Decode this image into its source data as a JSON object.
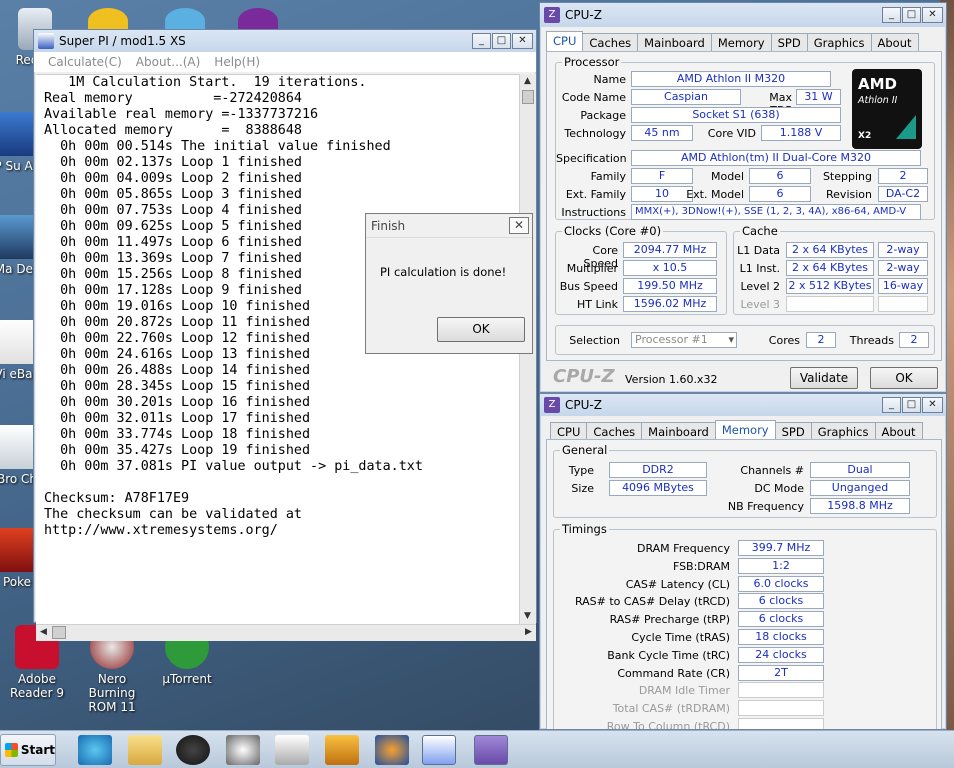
{
  "desktop": {
    "left_labels": [
      "Recycl",
      "HP Su Assi",
      "Ma Des",
      "Vi eBay",
      "Bro Ch",
      "Poke"
    ],
    "bottom_icons": [
      {
        "label": "Adobe Reader 9",
        "icon": "adobe-reader-icon"
      },
      {
        "label": "Nero Burning ROM 11",
        "icon": "nero-icon"
      },
      {
        "label": "µTorrent",
        "icon": "utorrent-icon"
      }
    ]
  },
  "superpi": {
    "title": "Super PI / mod1.5 XS",
    "menu": [
      "Calculate(C)",
      "About...(A)",
      "Help(H)"
    ],
    "output": [
      "   1M Calculation Start.  19 iterations.",
      "Real memory          =-272420864",
      "Available real memory =-1337737216",
      "Allocated memory      =  8388648",
      "  0h 00m 00.514s The initial value finished",
      "  0h 00m 02.137s Loop 1 finished",
      "  0h 00m 04.009s Loop 2 finished",
      "  0h 00m 05.865s Loop 3 finished",
      "  0h 00m 07.753s Loop 4 finished",
      "  0h 00m 09.625s Loop 5 finished",
      "  0h 00m 11.497s Loop 6 finished",
      "  0h 00m 13.369s Loop 7 finished",
      "  0h 00m 15.256s Loop 8 finished",
      "  0h 00m 17.128s Loop 9 finished",
      "  0h 00m 19.016s Loop 10 finished",
      "  0h 00m 20.872s Loop 11 finished",
      "  0h 00m 22.760s Loop 12 finished",
      "  0h 00m 24.616s Loop 13 finished",
      "  0h 00m 26.488s Loop 14 finished",
      "  0h 00m 28.345s Loop 15 finished",
      "  0h 00m 30.201s Loop 16 finished",
      "  0h 00m 32.011s Loop 17 finished",
      "  0h 00m 33.774s Loop 18 finished",
      "  0h 00m 35.427s Loop 19 finished",
      "  0h 00m 37.081s PI value output -> pi_data.txt",
      "",
      "Checksum: A78F17E9",
      "The checksum can be validated at",
      "http://www.xtremesystems.org/"
    ]
  },
  "finish_dialog": {
    "title": "Finish",
    "message": "PI calculation is done!",
    "ok": "OK"
  },
  "cpuz1": {
    "title": "CPU-Z",
    "tabs": [
      "CPU",
      "Caches",
      "Mainboard",
      "Memory",
      "SPD",
      "Graphics",
      "About"
    ],
    "active_tab": "CPU",
    "processor": {
      "group": "Processor",
      "name_l": "Name",
      "name": "AMD Athlon II M320",
      "code_l": "Code Name",
      "code": "Caspian",
      "tdp_l": "Max TDP",
      "tdp": "31 W",
      "pkg_l": "Package",
      "pkg": "Socket S1 (638)",
      "tech_l": "Technology",
      "tech": "45 nm",
      "vid_l": "Core VID",
      "vid": "1.188 V",
      "spec_l": "Specification",
      "spec": "AMD Athlon(tm) II Dual-Core M320",
      "fam_l": "Family",
      "fam": "F",
      "model_l": "Model",
      "model": "6",
      "step_l": "Stepping",
      "step": "2",
      "xfam_l": "Ext. Family",
      "xfam": "10",
      "xmodel_l": "Ext. Model",
      "xmodel": "6",
      "rev_l": "Revision",
      "rev": "DA-C2",
      "instr_l": "Instructions",
      "instr": "MMX(+), 3DNow!(+), SSE (1, 2, 3, 4A), x86-64, AMD-V"
    },
    "logo": {
      "brand": "AMD",
      "line": "Athlon II",
      "tag": "X2"
    },
    "clocks": {
      "group": "Clocks (Core #0)",
      "speed_l": "Core Speed",
      "speed": "2094.77 MHz",
      "mult_l": "Multiplier",
      "mult": "x 10.5",
      "bus_l": "Bus Speed",
      "bus": "199.50 MHz",
      "ht_l": "HT Link",
      "ht": "1596.02 MHz"
    },
    "cache": {
      "group": "Cache",
      "l1d_l": "L1 Data",
      "l1d": "2 x 64 KBytes",
      "l1d_w": "2-way",
      "l1i_l": "L1 Inst.",
      "l1i": "2 x 64 KBytes",
      "l1i_w": "2-way",
      "l2_l": "Level 2",
      "l2": "2 x 512 KBytes",
      "l2_w": "16-way",
      "l3_l": "Level 3"
    },
    "sel_l": "Selection",
    "sel": "Processor #1",
    "cores_l": "Cores",
    "cores": "2",
    "threads_l": "Threads",
    "threads": "2",
    "brand": "CPU-Z",
    "version": "Version 1.60.x32",
    "validate": "Validate",
    "ok": "OK"
  },
  "cpuz2": {
    "title": "CPU-Z",
    "tabs": [
      "CPU",
      "Caches",
      "Mainboard",
      "Memory",
      "SPD",
      "Graphics",
      "About"
    ],
    "active_tab": "Memory",
    "general": {
      "group": "General",
      "type_l": "Type",
      "type": "DDR2",
      "size_l": "Size",
      "size": "4096 MBytes",
      "ch_l": "Channels #",
      "ch": "Dual",
      "dc_l": "DC Mode",
      "dc": "Unganged",
      "nb_l": "NB Frequency",
      "nb": "1598.8 MHz"
    },
    "timings": {
      "group": "Timings",
      "rows": [
        {
          "l": "DRAM Frequency",
          "v": "399.7 MHz"
        },
        {
          "l": "FSB:DRAM",
          "v": "1:2"
        },
        {
          "l": "CAS# Latency (CL)",
          "v": "6.0 clocks"
        },
        {
          "l": "RAS# to CAS# Delay (tRCD)",
          "v": "6 clocks"
        },
        {
          "l": "RAS# Precharge (tRP)",
          "v": "6 clocks"
        },
        {
          "l": "Cycle Time (tRAS)",
          "v": "18 clocks"
        },
        {
          "l": "Bank Cycle Time (tRC)",
          "v": "24 clocks"
        },
        {
          "l": "Command Rate (CR)",
          "v": "2T"
        },
        {
          "l": "DRAM Idle Timer",
          "v": ""
        },
        {
          "l": "Total CAS# (tRDRAM)",
          "v": ""
        },
        {
          "l": "Row To Column (tRCD)",
          "v": ""
        }
      ]
    }
  },
  "taskbar": {
    "start": "Start",
    "items": [
      "ie-icon",
      "explorer-icon",
      "hp-icon",
      "spider-solitaire-icon",
      "solitaire-icon",
      "media-player-icon",
      "firefox-icon",
      "superpi-icon",
      "cpuz-icon"
    ]
  }
}
